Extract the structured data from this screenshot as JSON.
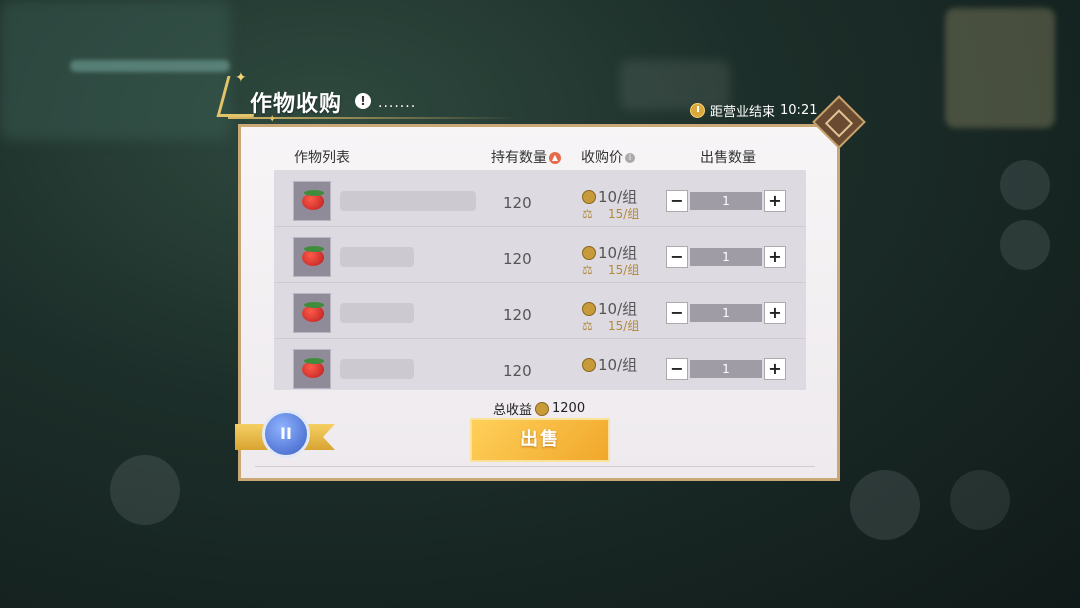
{
  "header": {
    "title": "作物收购",
    "info_badge": "!",
    "dots": ".......",
    "timer_label": "距营业结束",
    "timer_value": "10:21"
  },
  "table": {
    "columns": [
      "作物列表",
      "持有数量",
      "收购价",
      "出售数量"
    ],
    "rows": [
      {
        "qty": "120",
        "price": "10/组",
        "ref_price": "15/组",
        "sell_qty": "1",
        "name_blur_width": 136
      },
      {
        "qty": "120",
        "price": "10/组",
        "ref_price": "15/组",
        "sell_qty": "1",
        "name_blur_width": 74
      },
      {
        "qty": "120",
        "price": "10/组",
        "ref_price": "15/组",
        "sell_qty": "1",
        "name_blur_width": 74
      },
      {
        "qty": "120",
        "price": "10/组",
        "ref_price": "",
        "sell_qty": "1",
        "name_blur_width": 74
      }
    ]
  },
  "footer": {
    "total_label": "总收益",
    "total_value": "1200",
    "sell_label": "出售",
    "rank_label": "II"
  },
  "stepper": {
    "minus": "−",
    "plus": "+"
  },
  "icons": {
    "clock": "clock-icon",
    "coin": "coin-icon",
    "scale": "scale-icon",
    "knot": "knot-icon"
  },
  "colors": {
    "accent_gold": "#f0a72b",
    "panel_border": "#c9a876"
  }
}
